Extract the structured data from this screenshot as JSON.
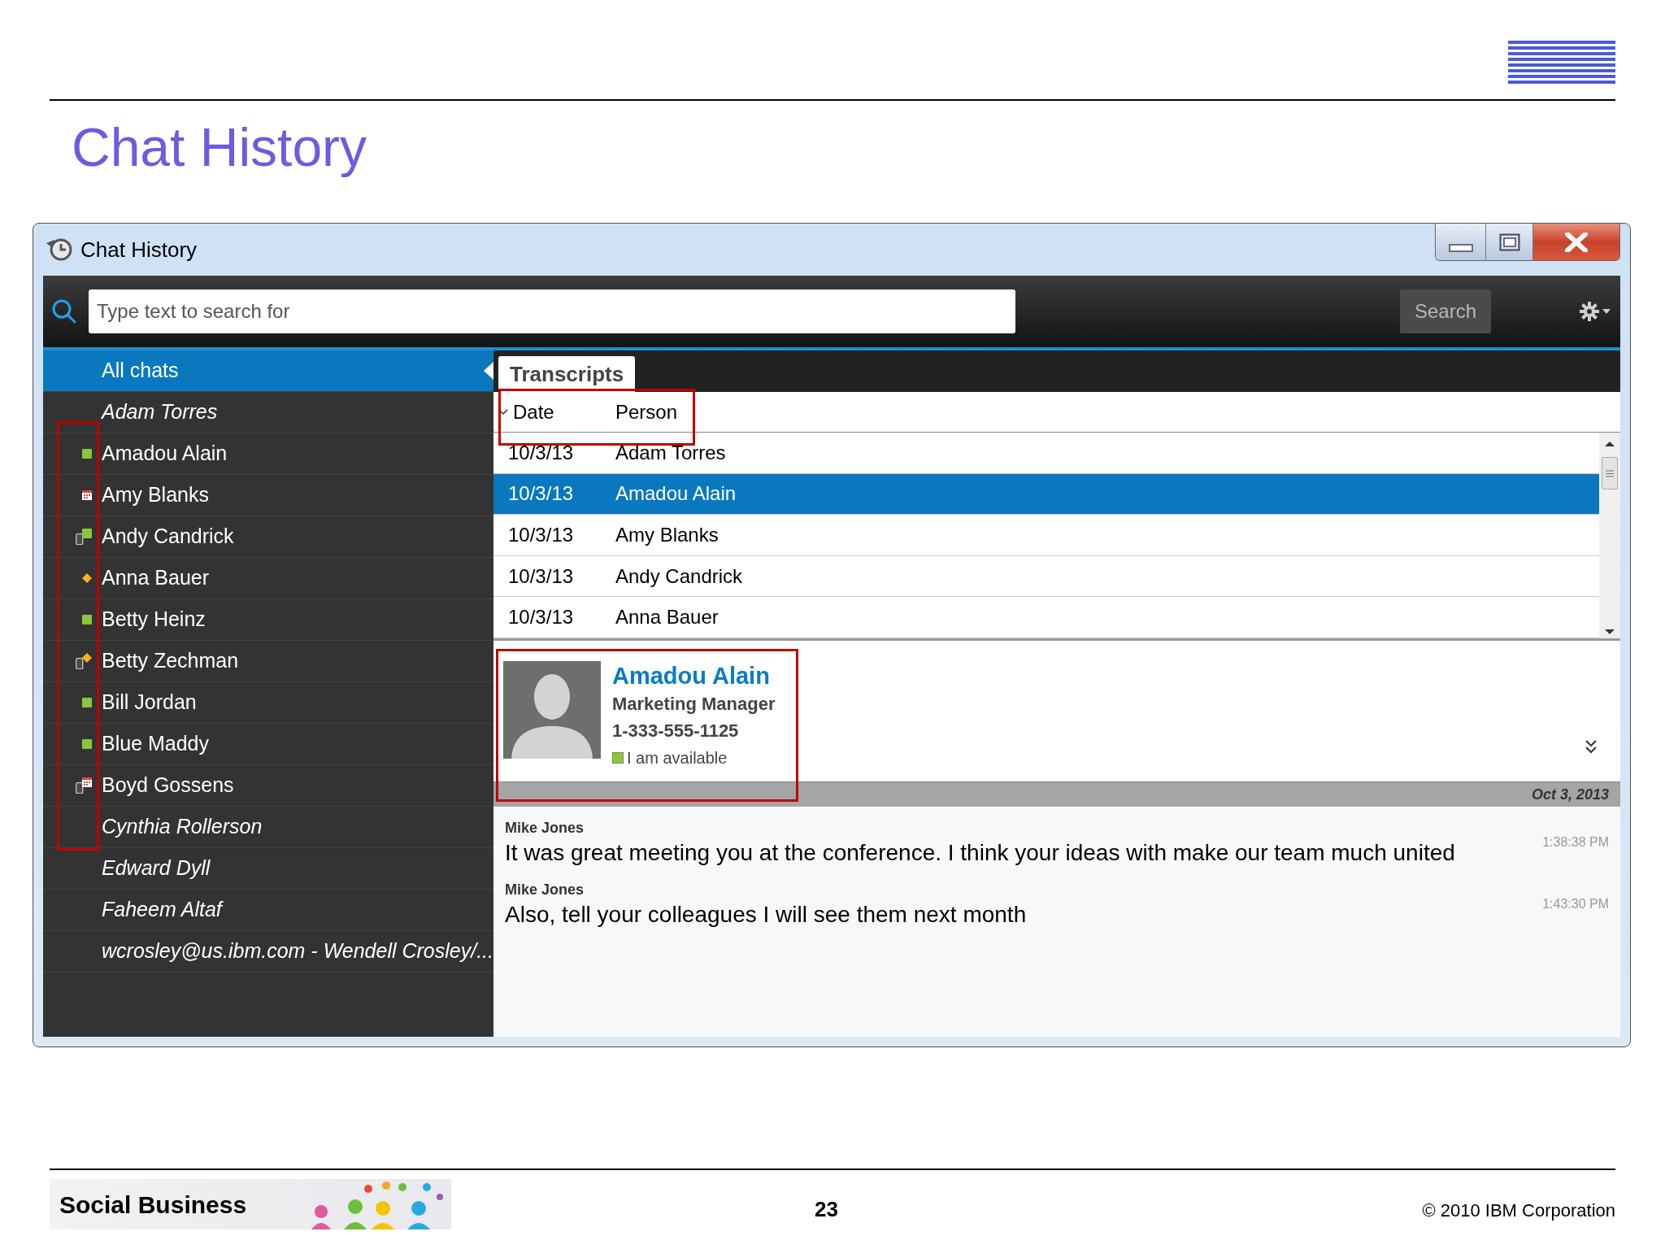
{
  "slide": {
    "title": "Chat History",
    "page_number": "23",
    "copyright": "© 2010 IBM Corporation",
    "footer_brand": "Social Business"
  },
  "window": {
    "title": "Chat History"
  },
  "search": {
    "placeholder": "Type text to search for",
    "button": "Search"
  },
  "sidebar": {
    "items": [
      {
        "label": "All chats",
        "selected": true,
        "offline": false
      },
      {
        "label": "Adam Torres",
        "selected": false,
        "offline": true
      },
      {
        "label": "Amadou Alain",
        "selected": false,
        "offline": false,
        "kind": "available"
      },
      {
        "label": "Amy Blanks",
        "selected": false,
        "offline": false,
        "kind": "meeting"
      },
      {
        "label": "Andy Candrick",
        "selected": false,
        "offline": false,
        "kind": "mobile"
      },
      {
        "label": "Anna Bauer",
        "selected": false,
        "offline": false,
        "kind": "away"
      },
      {
        "label": "Betty Heinz",
        "selected": false,
        "offline": false,
        "kind": "available"
      },
      {
        "label": "Betty Zechman",
        "selected": false,
        "offline": false,
        "kind": "mobileaway"
      },
      {
        "label": "Bill Jordan",
        "selected": false,
        "offline": false,
        "kind": "available"
      },
      {
        "label": "Blue Maddy",
        "selected": false,
        "offline": false,
        "kind": "available"
      },
      {
        "label": "Boyd Gossens",
        "selected": false,
        "offline": false,
        "kind": "mobilemeeting"
      },
      {
        "label": "Cynthia Rollerson",
        "selected": false,
        "offline": true
      },
      {
        "label": "Edward Dyll",
        "selected": false,
        "offline": true
      },
      {
        "label": "Faheem Altaf",
        "selected": false,
        "offline": true
      },
      {
        "label": "wcrosley@us.ibm.com - Wendell Crosley/...",
        "selected": false,
        "offline": true
      }
    ]
  },
  "tabs": [
    {
      "label": "Transcripts",
      "selected": true
    }
  ],
  "table": {
    "columns": [
      "Date",
      "Person"
    ],
    "rows": [
      {
        "date": "10/3/13",
        "person": "Adam Torres",
        "selected": false
      },
      {
        "date": "10/3/13",
        "person": "Amadou Alain",
        "selected": true
      },
      {
        "date": "10/3/13",
        "person": "Amy Blanks",
        "selected": false
      },
      {
        "date": "10/3/13",
        "person": "Andy Candrick",
        "selected": false
      },
      {
        "date": "10/3/13",
        "person": "Anna Bauer",
        "selected": false
      }
    ]
  },
  "profile": {
    "name": "Amadou Alain",
    "title": "Marketing Manager",
    "phone": "1-333-555-1125",
    "available": true,
    "status_text": "I am available"
  },
  "transcript": {
    "date": "Oct 3, 2013",
    "messages": [
      {
        "sender": "Mike Jones",
        "text": "It was great meeting you at the conference.  I think your ideas with make our team much united",
        "time": "1:38:38 PM"
      },
      {
        "sender": "Mike Jones",
        "text": "Also, tell your colleagues I will see them next month",
        "time": "1:43:30 PM"
      }
    ]
  }
}
